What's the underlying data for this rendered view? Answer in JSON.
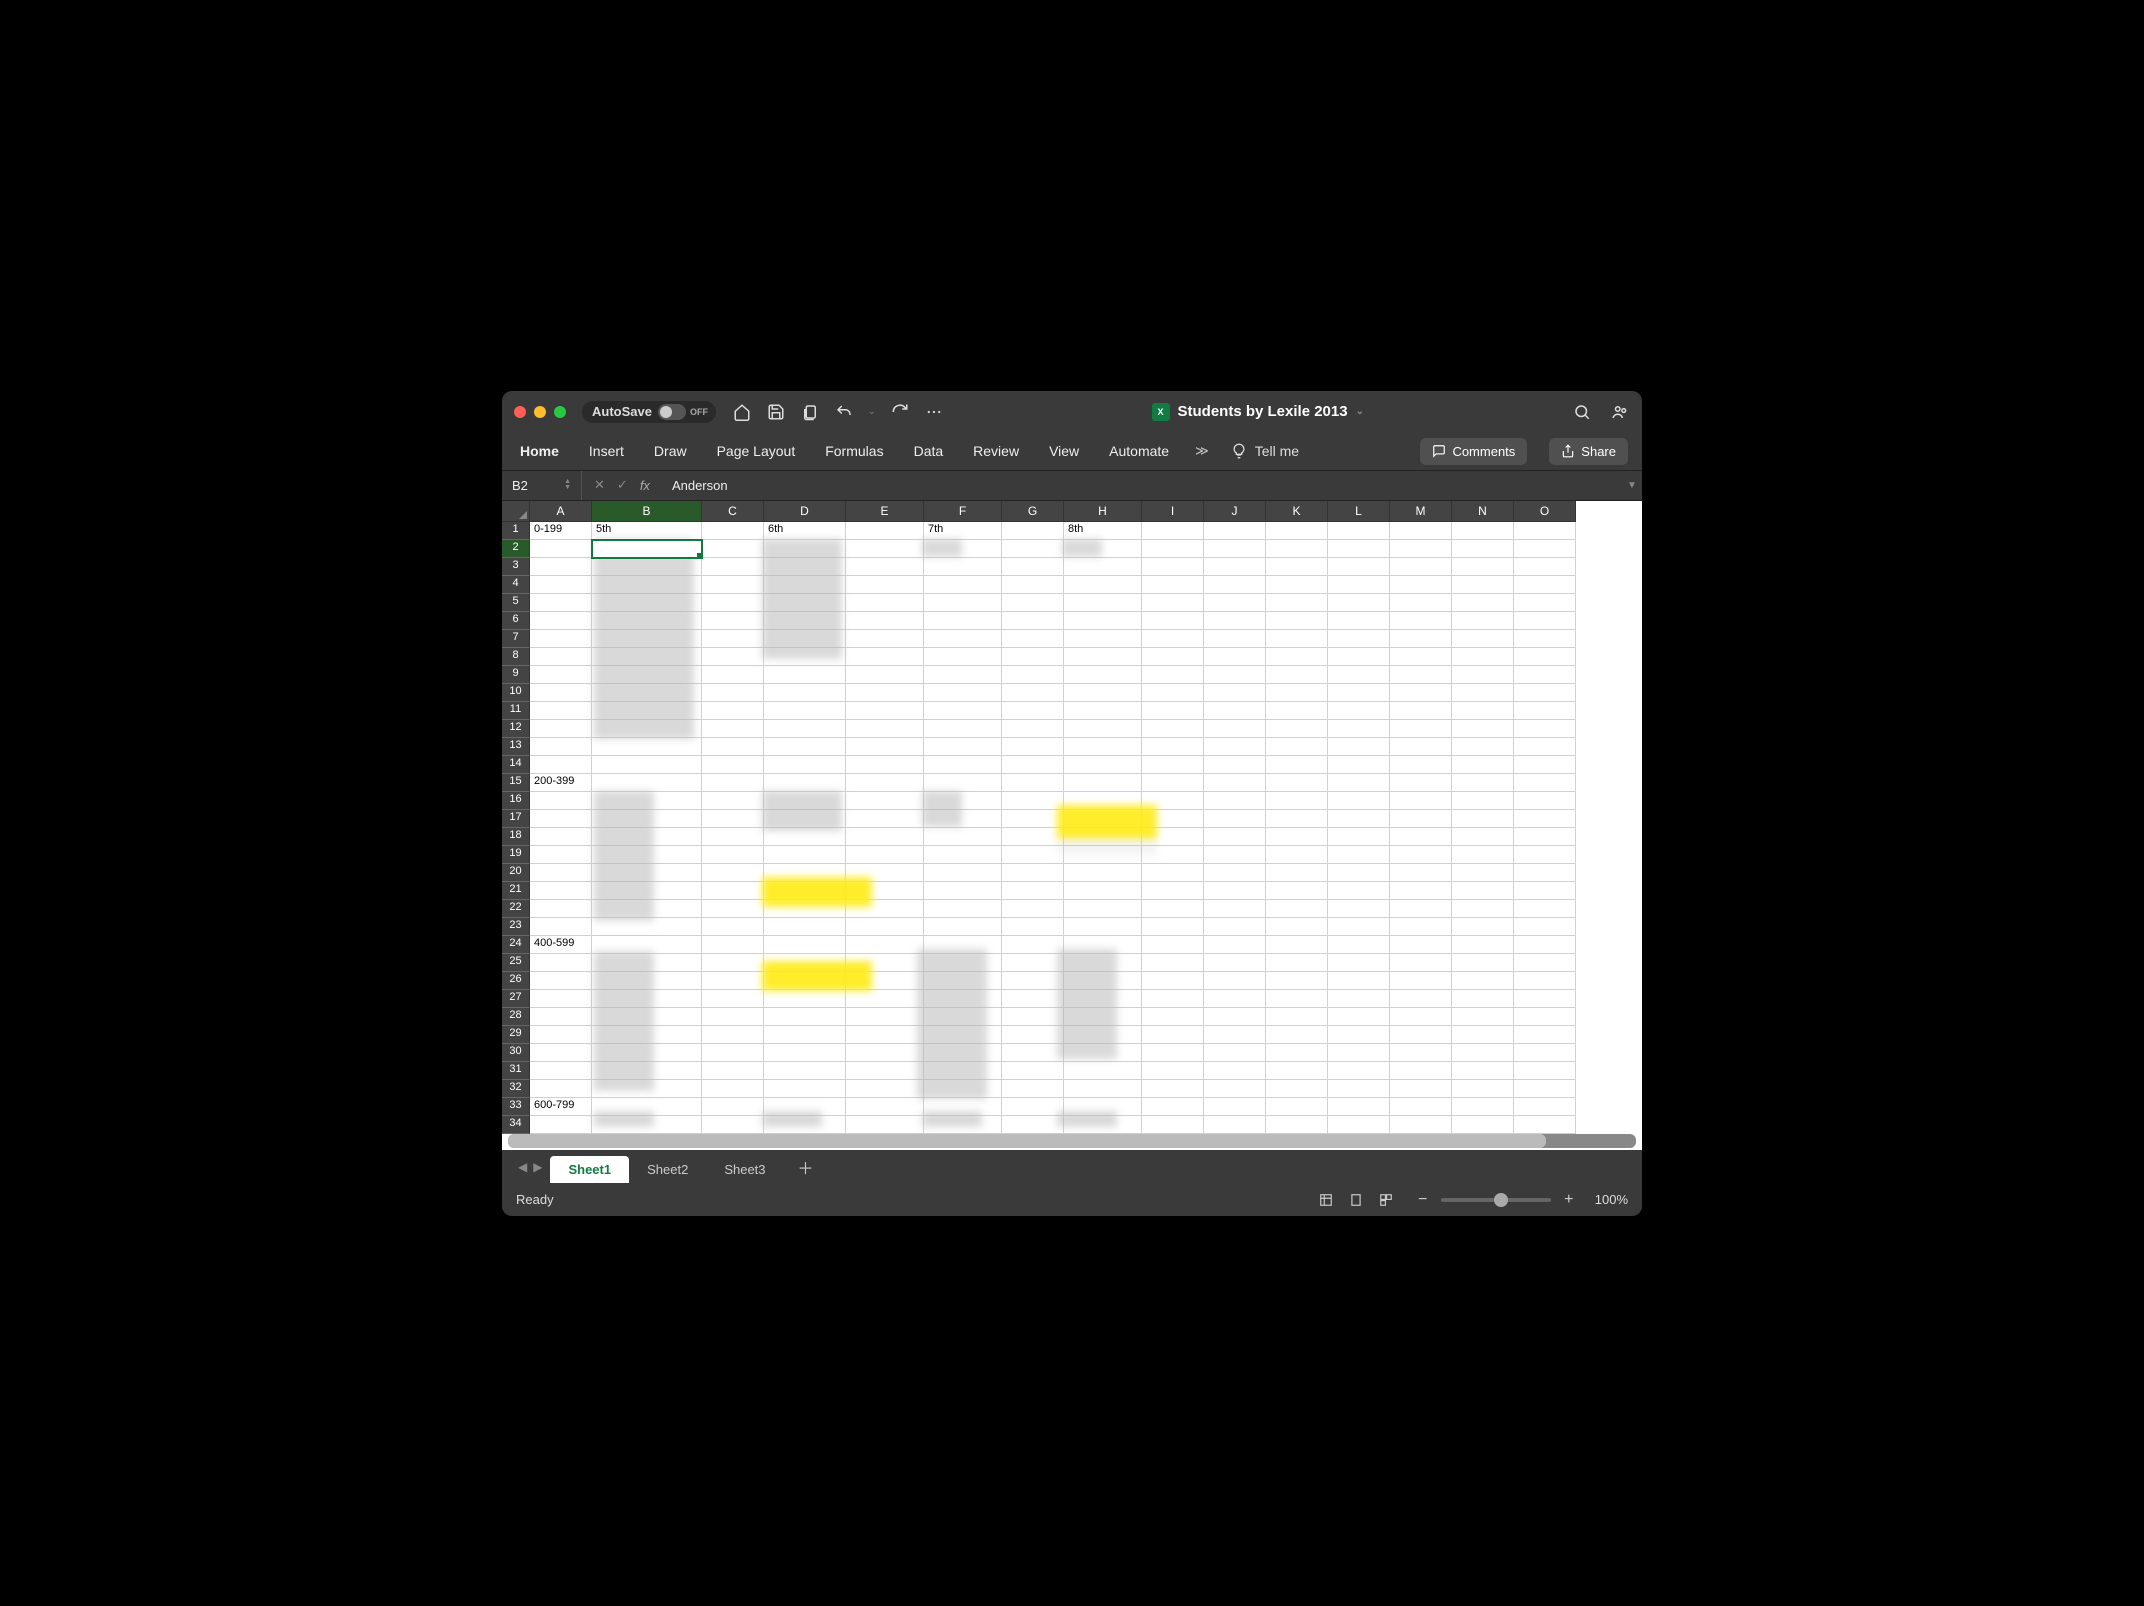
{
  "titlebar": {
    "autosave_label": "AutoSave",
    "autosave_state": "OFF",
    "document_title": "Students by Lexile 2013"
  },
  "ribbon": {
    "tabs": [
      "Home",
      "Insert",
      "Draw",
      "Page Layout",
      "Formulas",
      "Data",
      "Review",
      "View",
      "Automate"
    ],
    "tellme": "Tell me",
    "comments_label": "Comments",
    "share_label": "Share"
  },
  "formula_bar": {
    "name_box": "B2",
    "formula_value": "Anderson"
  },
  "columns": [
    "A",
    "B",
    "C",
    "D",
    "E",
    "F",
    "G",
    "H",
    "I",
    "J",
    "K",
    "L",
    "M",
    "N",
    "O"
  ],
  "selected_cell": "B2",
  "selected_col": "B",
  "selected_row": 2,
  "row_count": 34,
  "cells": {
    "A1": "0-199",
    "B1": "5th",
    "D1": "6th",
    "F1": "7th",
    "H1": "8th",
    "A15": "200-399",
    "A24": "400-599",
    "A33": "600-799"
  },
  "sheets": {
    "tabs": [
      "Sheet1",
      "Sheet2",
      "Sheet3"
    ],
    "active": 0
  },
  "status": {
    "text": "Ready",
    "zoom": "100%"
  }
}
